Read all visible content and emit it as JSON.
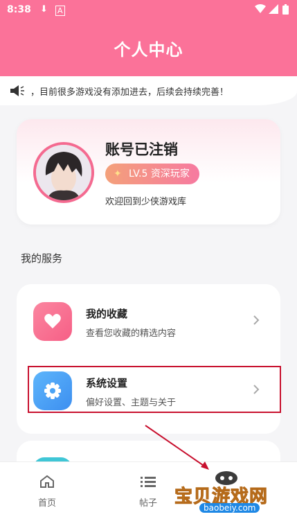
{
  "statusbar": {
    "time": "8:38"
  },
  "header": {
    "title": "个人中心"
  },
  "notice": {
    "text": "，目前很多游戏没有添加进去，后续会持续完善！"
  },
  "profile": {
    "username": "账号已注销",
    "level": "LV.5 资深玩家",
    "welcome": "欢迎回到少侠游戏库"
  },
  "services": {
    "title": "我的服务",
    "items": [
      {
        "title": "我的收藏",
        "desc": "查看您收藏的精选内容",
        "icon": "heart-icon",
        "color": "#fb6f8f"
      },
      {
        "title": "系统设置",
        "desc": "偏好设置、主题与关于",
        "icon": "gear-icon",
        "color": "#4aa3f5"
      }
    ]
  },
  "tabs": [
    {
      "label": "首页",
      "icon": "home-icon"
    },
    {
      "label": "帖子",
      "icon": "list-icon"
    }
  ],
  "watermark": {
    "text": "宝贝游戏网",
    "url": "baobeiy.com"
  },
  "colors": {
    "accent": "#fb7299",
    "highlight": "#c8102e"
  }
}
